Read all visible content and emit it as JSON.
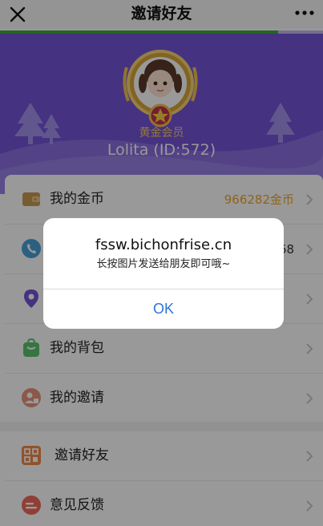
{
  "nav": {
    "title": "邀请好友",
    "close_icon": "close-icon",
    "more_icon": "more-icon"
  },
  "progress": {
    "value_percent": 86,
    "color": "#3aa83a"
  },
  "profile": {
    "level": "黄金会员",
    "name": "Lolita (ID:572)",
    "header_color": "#7454d8"
  },
  "menu_group_1": [
    {
      "label": "我的金币",
      "value": "966282金币",
      "icon": "wallet-icon",
      "icon_color": "#c99a52"
    },
    {
      "label": "",
      "value": "68",
      "icon": "phone-icon",
      "icon_color": "#4aa0d8"
    },
    {
      "label": "",
      "value": "",
      "icon": "location-pin-icon",
      "icon_color": "#7454d8"
    },
    {
      "label": "我的背包",
      "value": "",
      "icon": "backpack-icon",
      "icon_color": "#5cc170"
    },
    {
      "label": "我的邀请",
      "value": "",
      "icon": "user-badge-icon",
      "icon_color": "#e8937a"
    }
  ],
  "menu_group_2": [
    {
      "label": "邀请好友",
      "value": "",
      "icon": "qrcode-icon",
      "icon_color": "#f08a4a"
    },
    {
      "label": "意见反馈",
      "value": "",
      "icon": "feedback-icon",
      "icon_color": "#f06a5a"
    }
  ],
  "dialog": {
    "title": "fssw.bichonfrise.cn",
    "message": "长按图片发送给朋友即可哦~",
    "ok_label": "OK"
  }
}
